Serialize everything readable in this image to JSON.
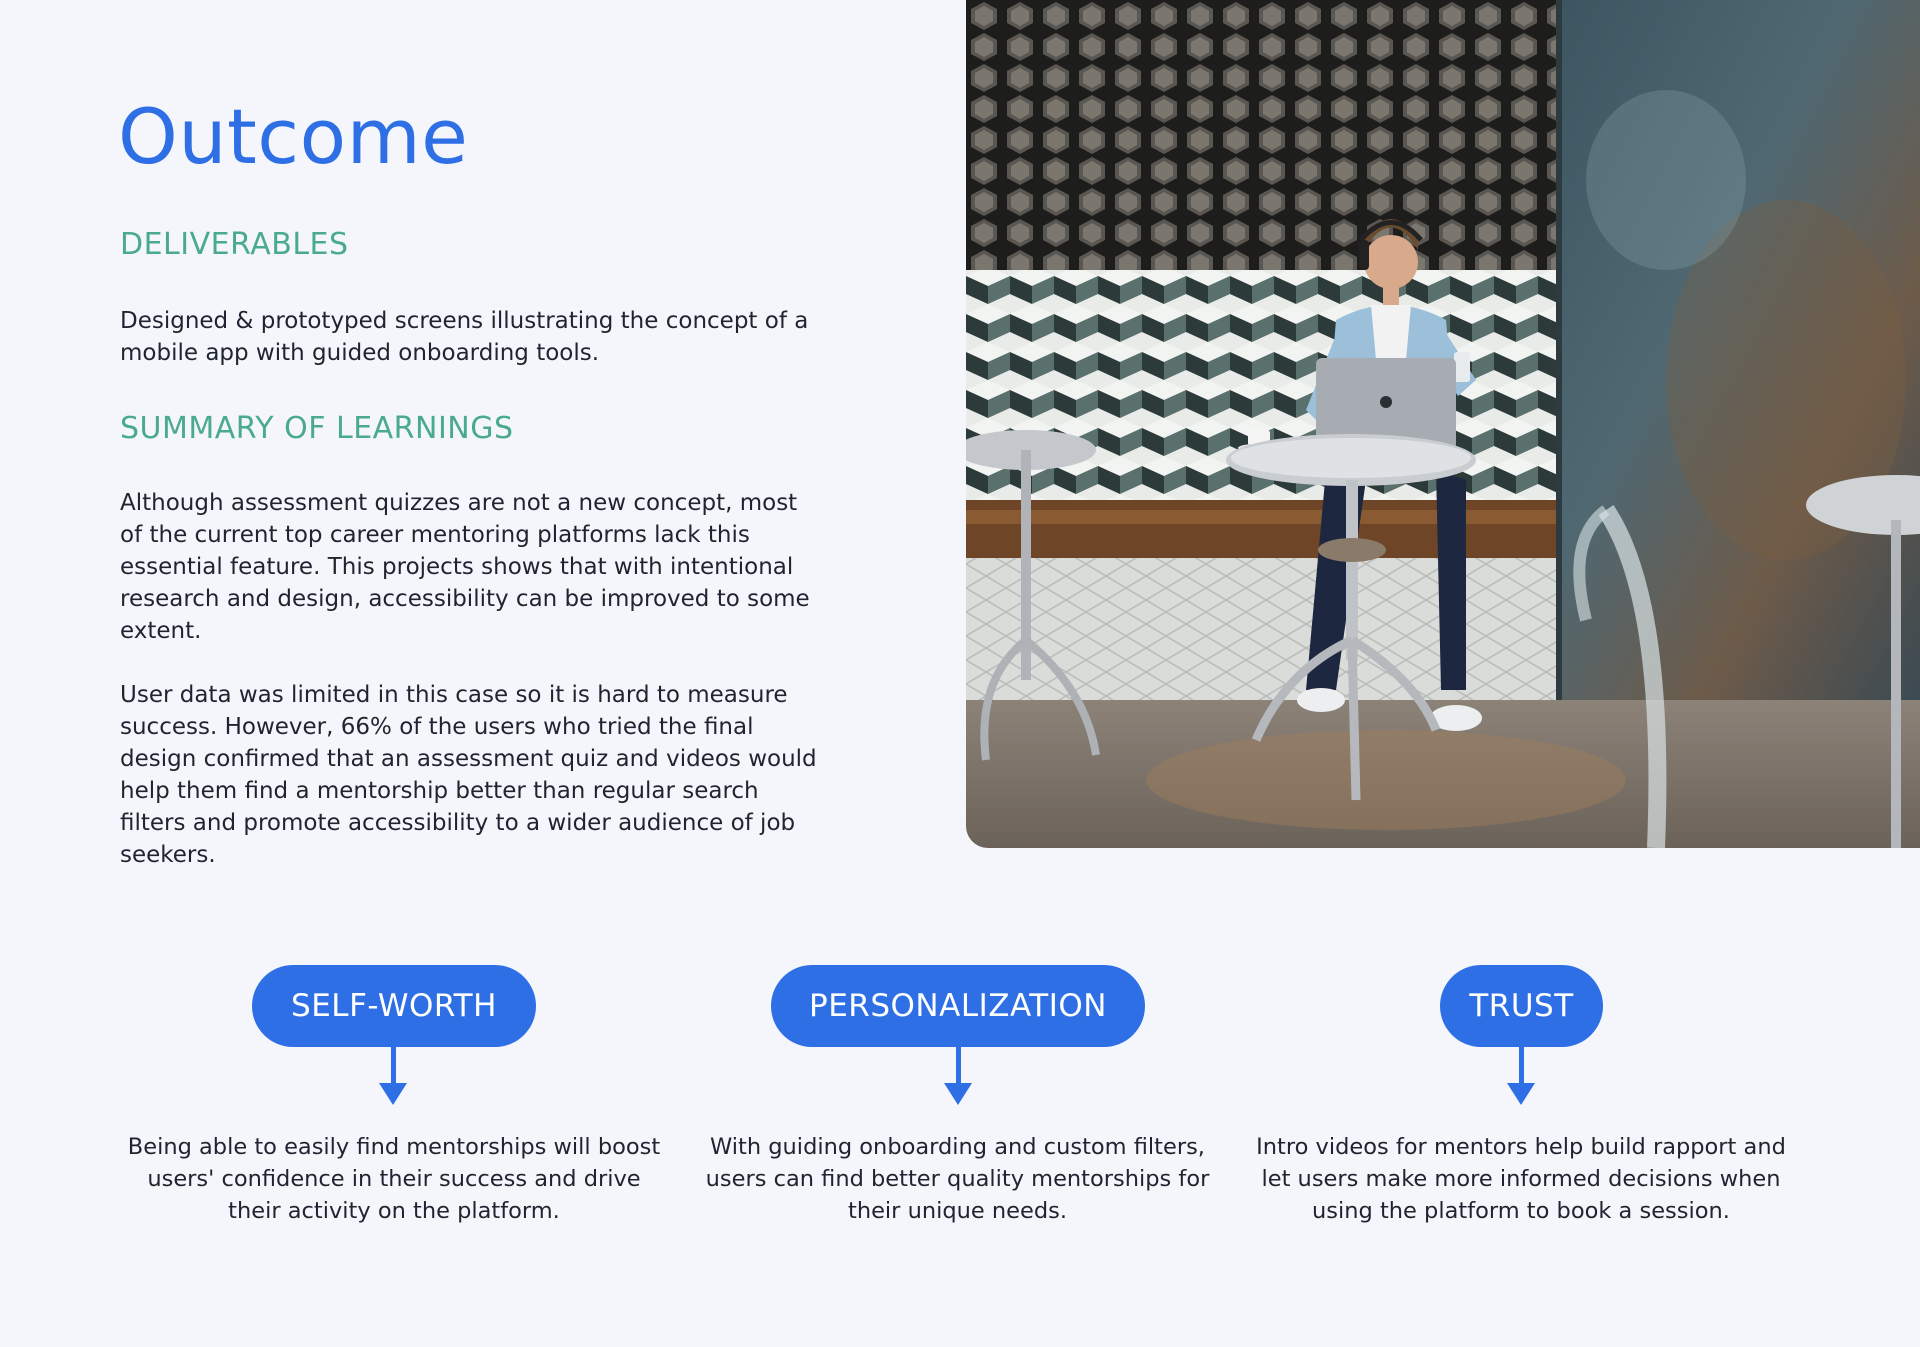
{
  "page": {
    "title": "Outcome",
    "accent_color": "#2f6fe6",
    "heading_color": "#4aaa90"
  },
  "deliverables": {
    "heading": "DELIVERABLES",
    "text": "Designed & prototyped screens illustrating the concept of a mobile app with guided onboarding tools."
  },
  "learnings": {
    "heading": "SUMMARY OF LEARNINGS",
    "paragraph1": "Although assessment quizzes are not a new concept, most of the current top career mentoring platforms lack this essential feature. This projects shows that with intentional research and design, accessibility can be improved to some extent.",
    "paragraph2": "User data was limited in this case so it is hard to measure success. However, 66% of the users who tried the final design confirmed that an assessment quiz and videos would help them find a mentorship better than regular search filters and promote accessibility to a wider audience of job seekers."
  },
  "photo": {
    "icon": "photo-man-laptop-cafe"
  },
  "pillars": [
    {
      "label": "SELF-WORTH",
      "text": "Being able to easily find mentorships will boost users' confidence in their success and drive their activity on the platform."
    },
    {
      "label": "PERSONALIZATION",
      "text": "With guiding onboarding and custom filters, users can find better quality mentorships for their unique needs."
    },
    {
      "label": "TRUST",
      "text": "Intro videos for mentors help build rapport and let users make more informed decisions when using the platform to book a session."
    }
  ]
}
